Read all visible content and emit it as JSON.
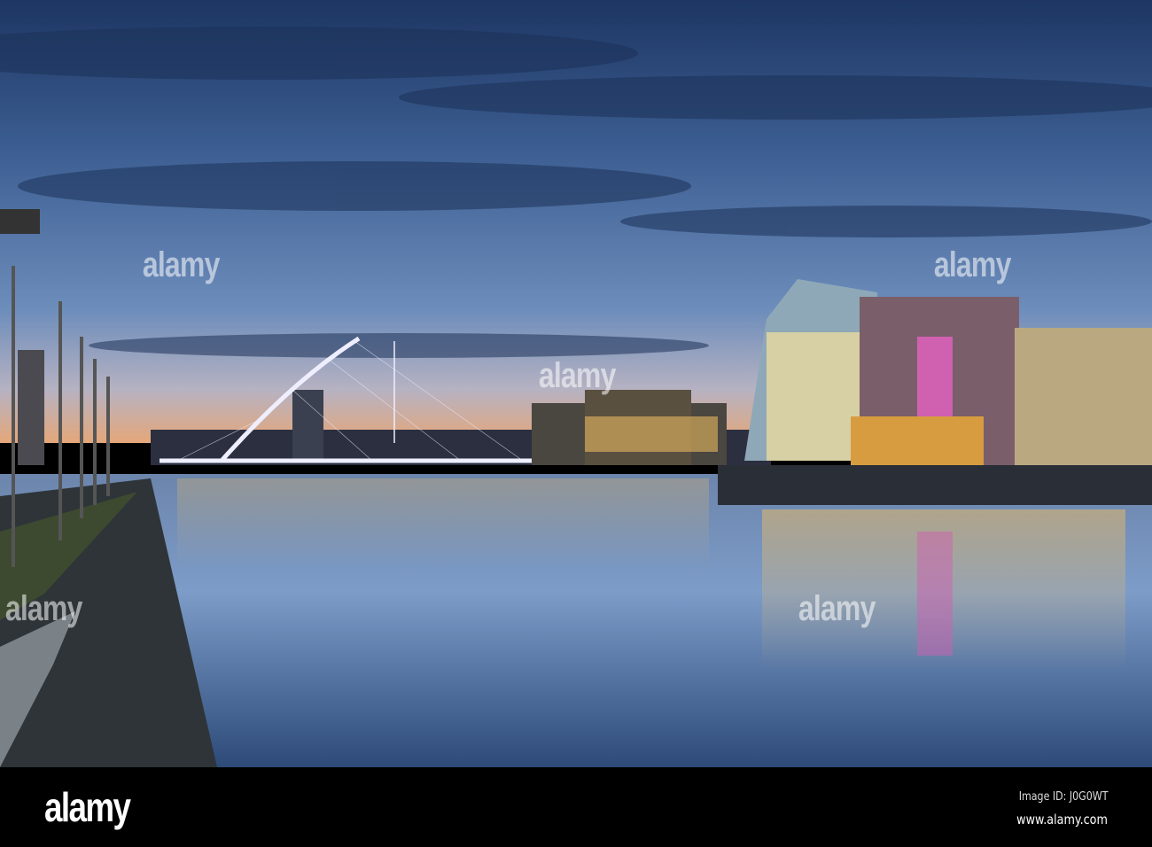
{
  "photo": {
    "subject": "River Liffey at dusk with Samuel Beckett Bridge and Convention Centre",
    "watermark": "alamy"
  },
  "footer": {
    "logo": "alamy",
    "image_id": "Image ID: J0G0WT",
    "website": "www.alamy.com"
  }
}
